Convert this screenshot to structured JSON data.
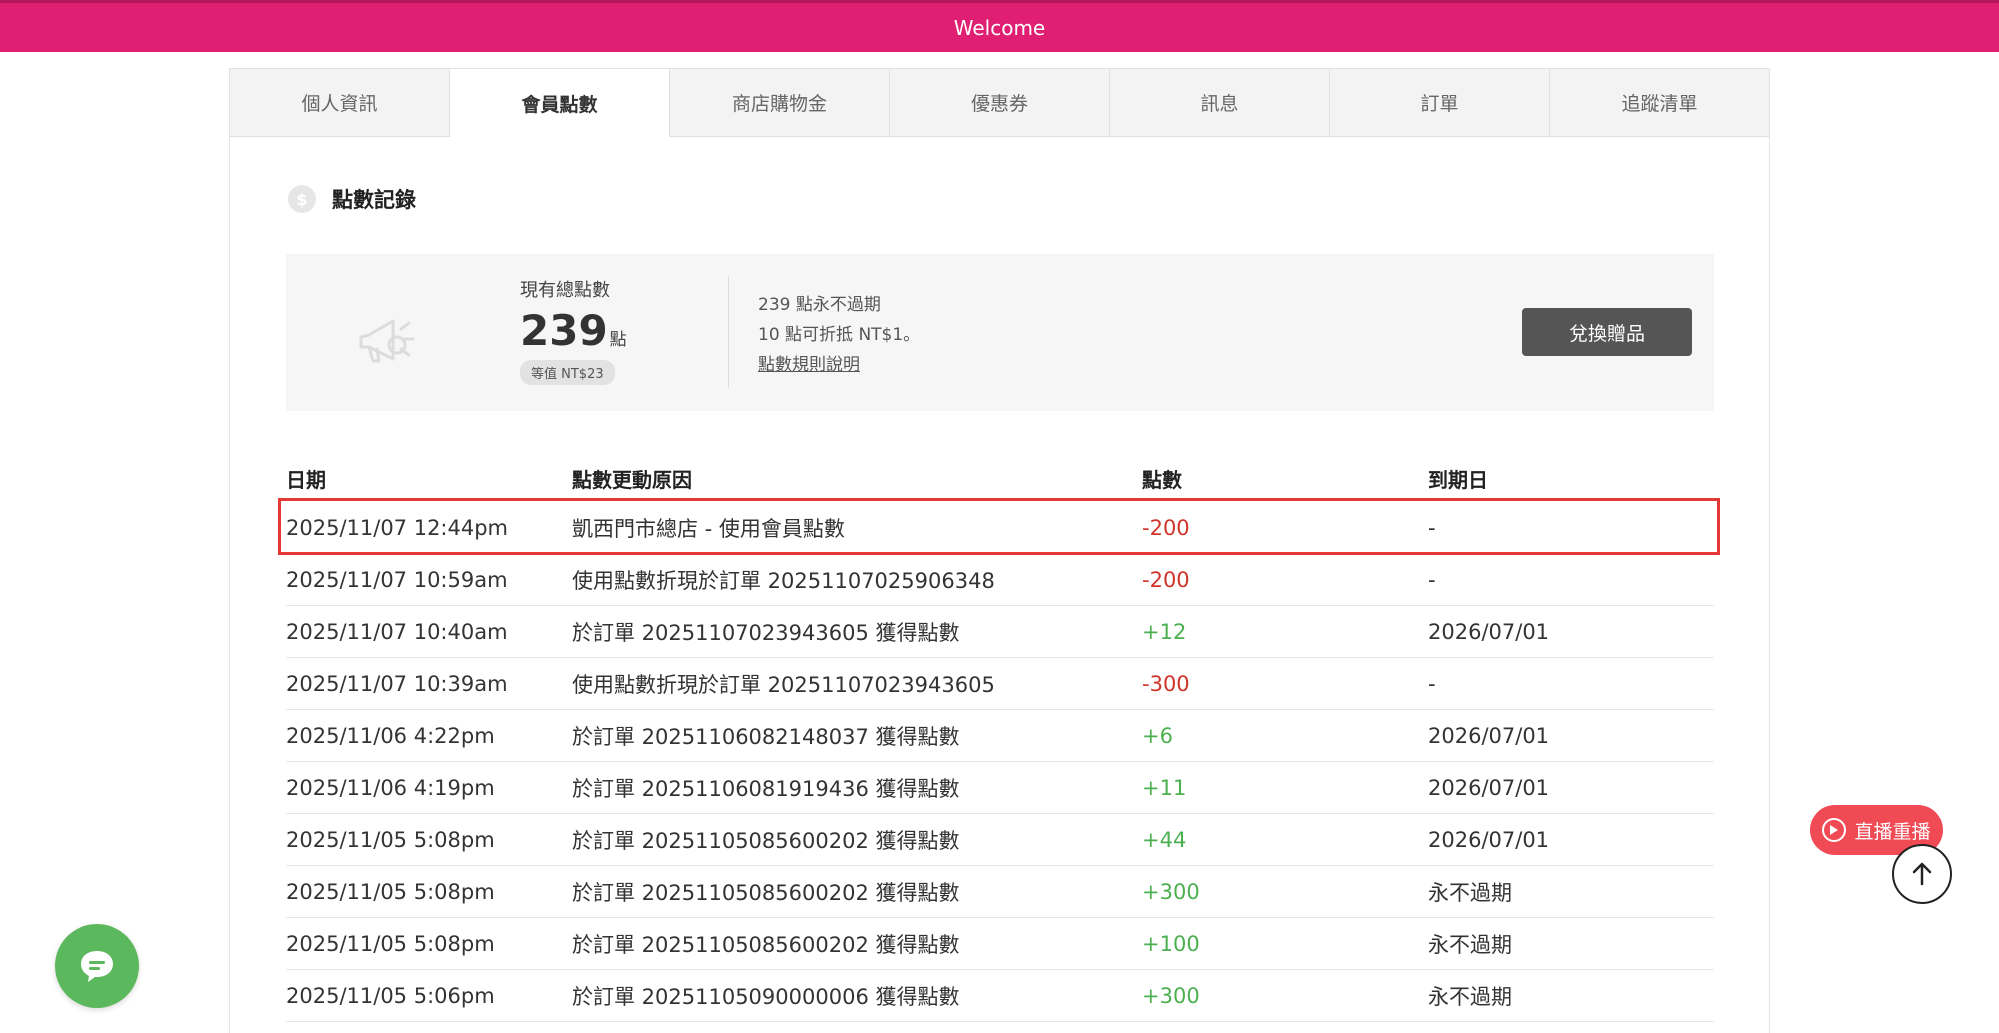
{
  "header": {
    "title": "Welcome"
  },
  "tabs": [
    {
      "label": "個人資訊",
      "active": false
    },
    {
      "label": "會員點數",
      "active": true
    },
    {
      "label": "商店購物金",
      "active": false
    },
    {
      "label": "優惠券",
      "active": false
    },
    {
      "label": "訊息",
      "active": false
    },
    {
      "label": "訂單",
      "active": false
    },
    {
      "label": "追蹤清單",
      "active": false
    }
  ],
  "section": {
    "title": "點數記錄",
    "icon": "dollar-coin-icon"
  },
  "summary": {
    "total_label": "現有總點數",
    "total_value": "239",
    "total_unit": "點",
    "equivalent": "等值 NT$23",
    "never_expire": "239 點永不過期",
    "conversion": "10 點可折抵 NT$1。",
    "rules_link": "點數規則說明",
    "redeem_button": "兌換贈品"
  },
  "table": {
    "headers": {
      "date": "日期",
      "reason": "點數更動原因",
      "points": "點數",
      "expiry": "到期日"
    },
    "rows": [
      {
        "date": "2025/11/07 12:44pm",
        "reason": "凱西門市總店 - 使用會員點數",
        "points": "-200",
        "expiry": "-"
      },
      {
        "date": "2025/11/07 10:59am",
        "reason": "使用點數折現於訂單 20251107025906348",
        "points": "-200",
        "expiry": "-"
      },
      {
        "date": "2025/11/07 10:40am",
        "reason": "於訂單 20251107023943605 獲得點數",
        "points": "+12",
        "expiry": "2026/07/01"
      },
      {
        "date": "2025/11/07 10:39am",
        "reason": "使用點數折現於訂單 20251107023943605",
        "points": "-300",
        "expiry": "-"
      },
      {
        "date": "2025/11/06 4:22pm",
        "reason": "於訂單 20251106082148037 獲得點數",
        "points": "+6",
        "expiry": "2026/07/01"
      },
      {
        "date": "2025/11/06 4:19pm",
        "reason": "於訂單 20251106081919436 獲得點數",
        "points": "+11",
        "expiry": "2026/07/01"
      },
      {
        "date": "2025/11/05 5:08pm",
        "reason": "於訂單 20251105085600202 獲得點數",
        "points": "+44",
        "expiry": "2026/07/01"
      },
      {
        "date": "2025/11/05 5:08pm",
        "reason": "於訂單 20251105085600202 獲得點數",
        "points": "+300",
        "expiry": "永不過期"
      },
      {
        "date": "2025/11/05 5:08pm",
        "reason": "於訂單 20251105085600202 獲得點數",
        "points": "+100",
        "expiry": "永不過期"
      },
      {
        "date": "2025/11/05 5:06pm",
        "reason": "於訂單 20251105090000006 獲得點數",
        "points": "+300",
        "expiry": "永不過期"
      }
    ]
  },
  "floating": {
    "live_replay": "直播重播",
    "chat_icon": "chat-bubble-icon",
    "top_icon": "arrow-up-icon"
  },
  "colors": {
    "brand": "#e01f73",
    "negative": "#d0352b",
    "positive": "#4caf50",
    "highlight": "#e53935",
    "chat": "#5cb85c",
    "live": "#f04a55"
  }
}
